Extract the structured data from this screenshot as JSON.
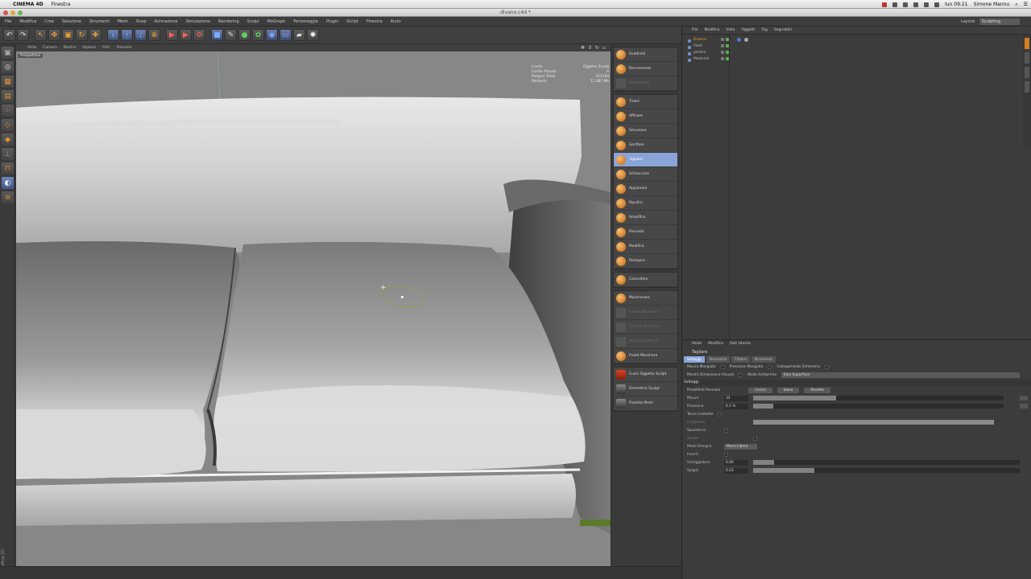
{
  "mac_menu": {
    "app": "CINEMA 4D",
    "items": [
      "Finestra"
    ],
    "clock": "lun 09:21",
    "user": "Simone Mannu"
  },
  "window_title": "divano.c4d *",
  "main_menu": {
    "items": [
      "File",
      "Modifica",
      "Crea",
      "Selezione",
      "Strumenti",
      "Mesh",
      "Snap",
      "Animazione",
      "Simulazione",
      "Rendering",
      "Scolpi",
      "MoGraph",
      "Personaggio",
      "Plugin",
      "Script",
      "Finestra",
      "Aiuto"
    ],
    "layout_label": "Layout:",
    "layout_value": "Sculpting"
  },
  "viewport": {
    "menu": [
      "Vista",
      "Camera",
      "Mostra",
      "Opzioni",
      "Filtri",
      "Pannello"
    ],
    "label": "Prospettiva",
    "hud": [
      {
        "k": "Livello",
        "v": "Oggetto Sculpt"
      },
      {
        "k": "Livello Attuale",
        "v": "4"
      },
      {
        "k": "Poligoni Totali",
        "v": "212160"
      },
      {
        "k": "Memoria",
        "v": "11.887 Mb"
      }
    ],
    "side_label": "Grafica 2D"
  },
  "ribbon": {
    "groups": [
      [
        {
          "label": "Suddividi",
          "state": "normal",
          "icon": "subdivide-icon"
        },
        {
          "label": "Decrementa",
          "state": "normal",
          "icon": "decrement-icon"
        },
        {
          "label": "Incrementa",
          "state": "disabled",
          "icon": "increment-icon"
        }
      ],
      [
        {
          "label": "Tirare",
          "state": "normal",
          "icon": "pull-brush-icon"
        },
        {
          "label": "Affinare",
          "state": "normal",
          "icon": "smooth-brush-icon"
        },
        {
          "label": "Smussare",
          "state": "normal",
          "icon": "bevel-brush-icon"
        },
        {
          "label": "Gonfiare",
          "state": "normal",
          "icon": "inflate-brush-icon"
        },
        {
          "label": "Tagliare",
          "state": "selected",
          "icon": "cut-brush-icon"
        },
        {
          "label": "Schiacciare",
          "state": "normal",
          "icon": "flatten-brush-icon"
        },
        {
          "label": "Appianare",
          "state": "normal",
          "icon": "fill-brush-icon"
        },
        {
          "label": "Ripulire",
          "state": "normal",
          "icon": "erase-brush-icon"
        },
        {
          "label": "Amplifica",
          "state": "normal",
          "icon": "amplify-brush-icon"
        },
        {
          "label": "Pennello",
          "state": "normal",
          "icon": "paint-brush-icon"
        },
        {
          "label": "Modifica",
          "state": "normal",
          "icon": "grab-brush-icon"
        },
        {
          "label": "Riempire",
          "state": "normal",
          "icon": "fill2-brush-icon"
        }
      ],
      [
        {
          "label": "Cancellare",
          "state": "normal",
          "icon": "eraser-brush-icon"
        }
      ],
      [
        {
          "label": "Mascherare",
          "state": "normal",
          "icon": "mask-brush-icon"
        },
        {
          "label": "Inverti Maschera",
          "state": "disabled",
          "icon": "invert-mask-icon"
        },
        {
          "label": "Elimina Maschera",
          "state": "disabled",
          "icon": "delete-mask-icon"
        },
        {
          "label": "Maschera Attiva",
          "state": "disabled",
          "icon": "mask-active-icon"
        },
        {
          "label": "Proiet Maschera",
          "state": "normal",
          "icon": "project-mask-icon"
        }
      ],
      [
        {
          "label": "Cuoci Oggetto Sculpt",
          "state": "normal",
          "icon": "bake-icon"
        },
        {
          "label": "Simmetria Sculpt",
          "state": "normal",
          "icon": "symmetry-icon"
        },
        {
          "label": "Proietta Mesh",
          "state": "normal",
          "icon": "project-mesh-icon"
        }
      ]
    ]
  },
  "object_manager": {
    "tabs": [
      "File",
      "Modifica",
      "Vista",
      "Oggetti",
      "Tag",
      "Segnalibri"
    ],
    "objects": [
      {
        "name": "Divano",
        "active": true
      },
      {
        "name": "Piedi",
        "active": false
      },
      {
        "name": "piedini",
        "active": false
      },
      {
        "name": "Materiali",
        "active": false
      }
    ]
  },
  "attribute_manager": {
    "tabs": [
      "Modo",
      "Modifica",
      "Dati Utente"
    ],
    "title": "Tagliare",
    "subtabs": [
      "Settaggi",
      "Simmetria",
      "Timbro",
      "Strumento"
    ],
    "row_link": {
      "a": "Misura Mangiata",
      "b": "Pressione Mangiata",
      "c": "Collegamento Simmetria"
    },
    "row_show": {
      "a": "Mostra Dimensione Visuale",
      "b": "Modo Anteprima",
      "v": "Solo Superficie"
    },
    "section": "Settaggi",
    "preset_label": "Predefiniti Pennello",
    "preset_buttons": [
      "Carica",
      "Salva",
      "Resetta"
    ],
    "misura": {
      "label": "Misura",
      "value": "33",
      "fill": 0.33
    },
    "pressione": {
      "label": "Pressione",
      "value": "6.1 %",
      "fill": 0.08
    },
    "falloff_label": "Tocco Costante",
    "larghezza_label": "Larghezza",
    "spaziatura_label": "Spaziatura",
    "spaziatura_sub": "Stroke",
    "modo_label": "Modo Disegno",
    "modo_value": "Mano Libera",
    "invert_label": "Inverti",
    "scheggiature": {
      "label": "Scheggiature",
      "value": "0.00",
      "fill": 0.08
    },
    "spigoli": {
      "label": "Spigoli",
      "value": "0.23",
      "fill": 0.23
    }
  }
}
